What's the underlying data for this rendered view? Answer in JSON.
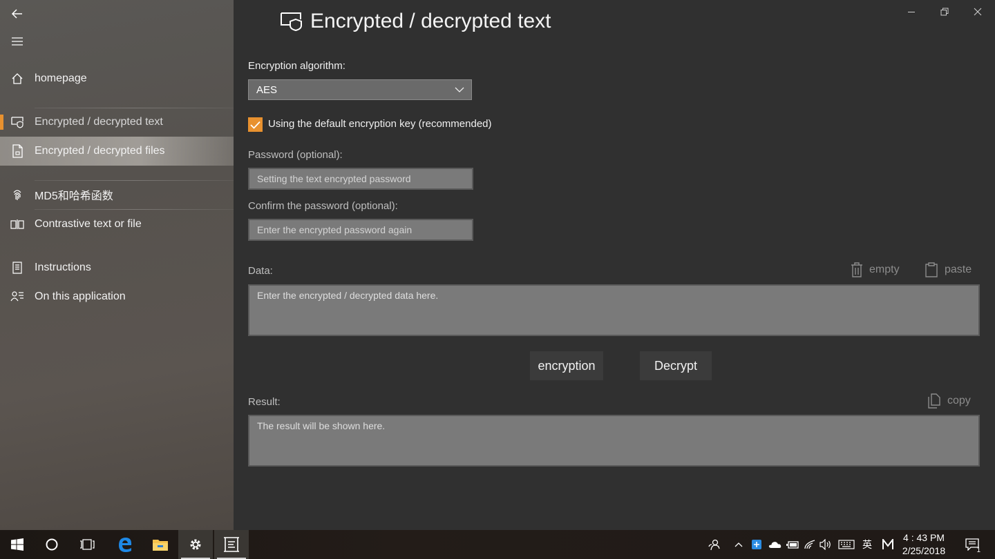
{
  "sidebar": {
    "items": [
      {
        "label": "homepage",
        "icon": "home-icon"
      },
      {
        "label": "Encrypted / decrypted text",
        "icon": "shield-icon"
      },
      {
        "label": "Encrypted / decrypted files",
        "icon": "file-lock-icon"
      },
      {
        "label": "MD5和哈希函数",
        "icon": "fingerprint-icon"
      },
      {
        "label": "Contrastive text or file",
        "icon": "compare-icon"
      },
      {
        "label": "Instructions",
        "icon": "book-icon"
      },
      {
        "label": "On this application",
        "icon": "about-icon"
      }
    ]
  },
  "page": {
    "title": "Encrypted / decrypted text",
    "algorithm_label": "Encryption algorithm:",
    "algorithm_value": "AES",
    "default_key_label": "Using the default encryption key (recommended)",
    "default_key_checked": true,
    "password_label": "Password (optional):",
    "password_placeholder": "Setting the text encrypted password",
    "confirm_label": "Confirm the password (optional):",
    "confirm_placeholder": "Enter the encrypted password again",
    "data_label": "Data:",
    "empty_label": "empty",
    "paste_label": "paste",
    "data_placeholder": "Enter the encrypted / decrypted data here.",
    "encrypt_button": "encryption",
    "decrypt_button": "Decrypt",
    "result_label": "Result:",
    "copy_label": "copy",
    "result_placeholder": "The result will be shown here."
  },
  "taskbar": {
    "ime_label": "英",
    "time": "4 : 43 PM",
    "date": "2/25/2018",
    "notification_count": "1"
  },
  "colors": {
    "accent": "#e8912f",
    "main_bg": "#303030",
    "field_bg": "#7a7a7a"
  }
}
